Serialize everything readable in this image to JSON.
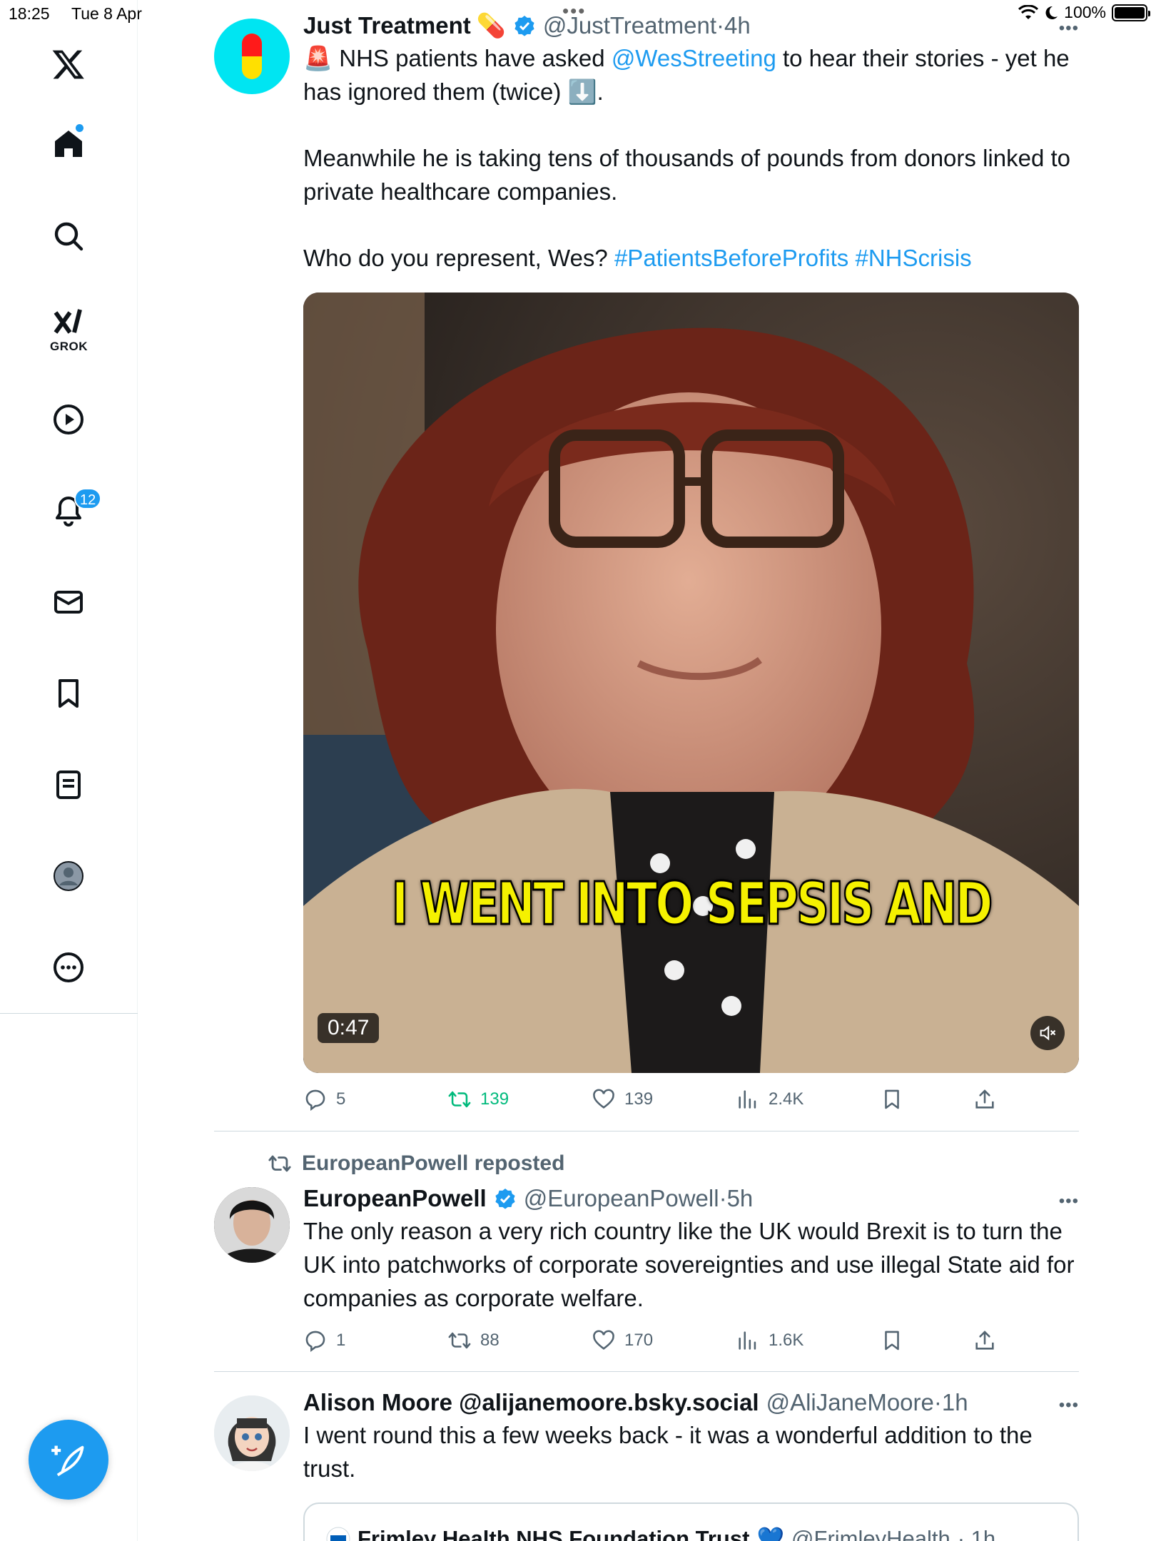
{
  "status_bar": {
    "time": "18:25",
    "date": "Tue 8 Apr",
    "multitask_dots": "•••",
    "battery": "100%",
    "battery_level": 1.0
  },
  "sidebar": {
    "grok_label": "GROK",
    "notifications_count": "12"
  },
  "colors": {
    "accent": "#1d9bf0",
    "repost_green": "#00ba7c",
    "caption_yellow": "#f5f100"
  },
  "tweets": [
    {
      "name": "Just Treatment",
      "name_emoji": "💊",
      "handle": "@JustTreatment",
      "sep": "·",
      "time": "4h",
      "text_line1_prefix": "🚨 NHS patients have asked ",
      "mention": "@WesStreeting",
      "text_line1_suffix": " to hear their stories - yet he has ignored them (twice) ⬇️.",
      "text_para2": "Meanwhile he is taking tens of thousands of pounds from donors linked to private healthcare companies.",
      "text_para3_prefix": "Who do you represent, Wes? ",
      "hashtag1": "#PatientsBeforeProfits",
      "hashtag2": "#NHScrisis",
      "video_caption": "I WENT INTO SEPSIS AND",
      "video_duration": "0:47",
      "replies": "5",
      "reposts": "139",
      "likes": "139",
      "views": "2.4K"
    },
    {
      "reposted_by": "EuropeanPowell reposted",
      "name": "EuropeanPowell",
      "handle": "@EuropeanPowell",
      "sep": "·",
      "time": "5h",
      "text": "The only reason a very rich country like the UK would Brexit is to turn the UK into patchworks of corporate sovereignties and use illegal State aid for companies as corporate welfare.",
      "replies": "1",
      "reposts": "88",
      "likes": "170",
      "views": "1.6K"
    },
    {
      "name": "Alison Moore @alijanemoore.bsky.social",
      "handle": "@AliJaneMoore",
      "sep": "·",
      "time": "1h",
      "text": "I went round this a few weeks back - it was a wonderful addition to the trust.",
      "quote_name": "Frimley Health NHS Foundation Trust",
      "quote_emoji": "💙",
      "quote_handle": "@FrimleyHealth",
      "quote_time": "· 1h"
    }
  ],
  "icons": [
    "x-logo-icon",
    "home-icon",
    "search-icon",
    "grok-icon",
    "video-icon",
    "bell-icon",
    "mail-icon",
    "bookmark-icon",
    "list-icon",
    "profile-icon",
    "more-icon",
    "compose-icon",
    "verified-icon",
    "reply-icon",
    "repost-icon",
    "like-icon",
    "views-icon",
    "share-icon",
    "mute-icon"
  ]
}
